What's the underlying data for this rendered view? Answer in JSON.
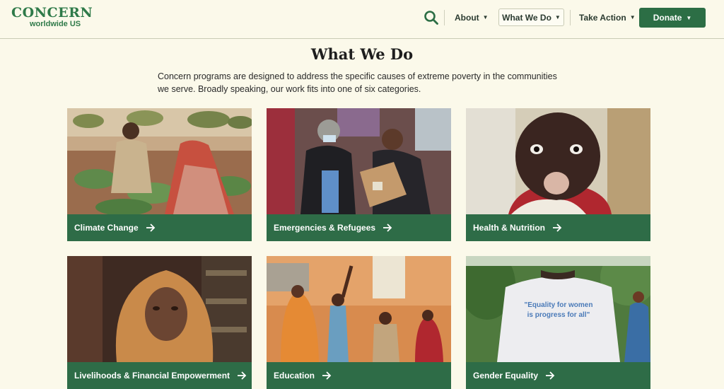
{
  "header": {
    "logo_main": "CONCERN",
    "logo_sub": "worldwide US",
    "nav": {
      "about": "About",
      "what_we_do": "What We Do",
      "take_action": "Take Action",
      "donate": "Donate"
    },
    "icons": {
      "search": "search-icon",
      "caret": "caret-down-icon"
    }
  },
  "page": {
    "title": "What We Do",
    "intro": "Concern programs are designed to address the specific causes of extreme poverty in the communities we serve. Broadly speaking, our work fits into one of six categories."
  },
  "cards": [
    {
      "label": "Climate Change",
      "image": "farmers-in-field"
    },
    {
      "label": "Emergencies & Refugees",
      "image": "aid-workers-with-boxes"
    },
    {
      "label": "Health & Nutrition",
      "image": "child-eating"
    },
    {
      "label": "Livelihoods & Financial Empowerment",
      "image": "woman-in-shop"
    },
    {
      "label": "Education",
      "image": "children-in-classroom"
    },
    {
      "label": "Gender Equality",
      "image": "shirt-slogan"
    }
  ],
  "shirt_text": {
    "line1": "\"Equality for women",
    "line2": "is progress for all\""
  },
  "colors": {
    "background": "#fbf9ea",
    "brand_green": "#2c6e45",
    "logo_green": "#2f7a49"
  }
}
